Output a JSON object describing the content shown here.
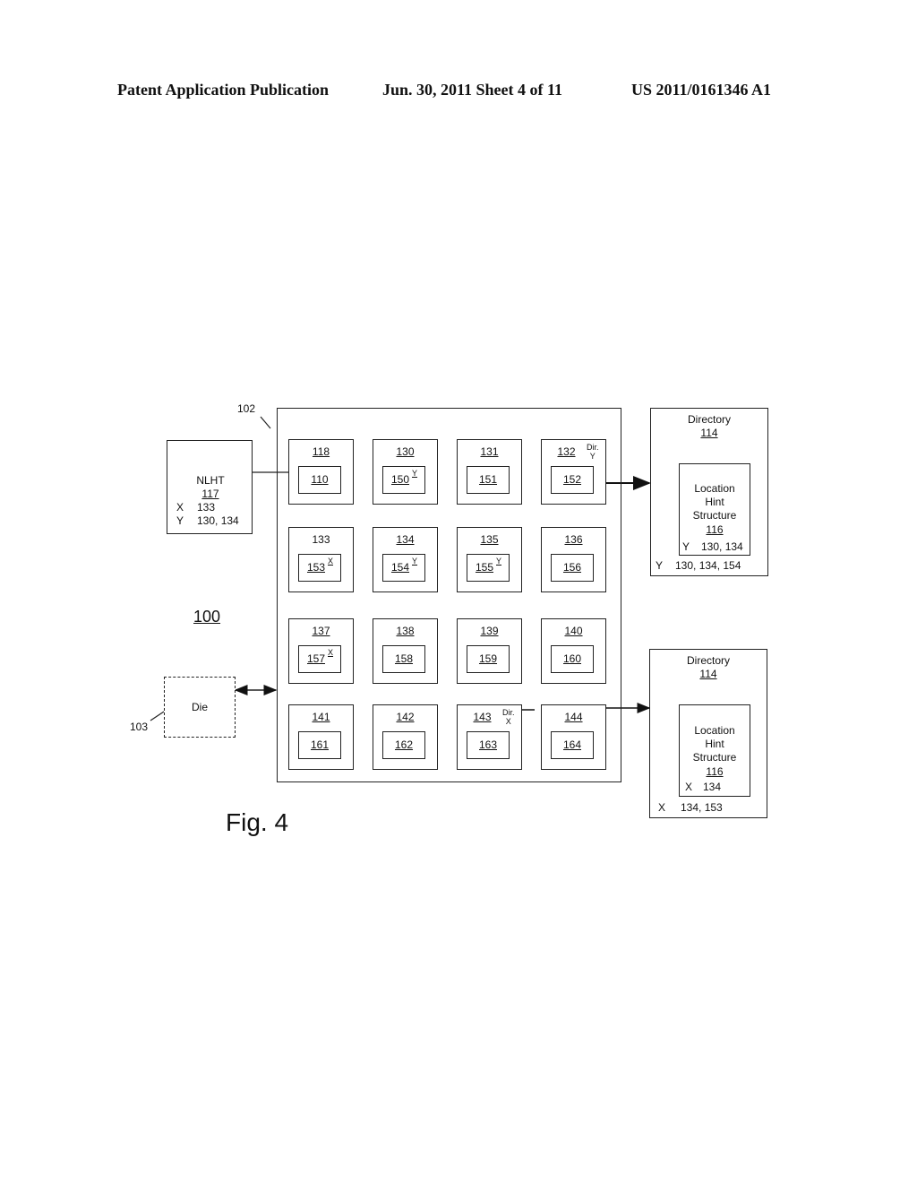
{
  "header": {
    "publication": "Patent Application Publication",
    "date_sheet": "Jun. 30, 2011  Sheet 4 of 11",
    "patent_number": "US 2011/0161346 A1"
  },
  "figure": {
    "caption": "Fig. 4",
    "system_ref": "100",
    "chip_ref": "102",
    "die_ref": "103",
    "die_label": "Die",
    "nlht": {
      "title": "NLHT",
      "ref": "117",
      "rows": [
        {
          "key": "X",
          "value": "133"
        },
        {
          "key": "Y",
          "value": "130, 134"
        }
      ]
    },
    "tiles": [
      {
        "tile": "118",
        "core": "110",
        "tile_underlined": true,
        "mark": ""
      },
      {
        "tile": "130",
        "core": "150",
        "tile_underlined": true,
        "mark": "Y"
      },
      {
        "tile": "131",
        "core": "151",
        "tile_underlined": true,
        "mark": ""
      },
      {
        "tile": "132",
        "core": "152",
        "tile_underlined": true,
        "mark": "",
        "dir": "Dir.",
        "dir_mark": "Y"
      },
      {
        "tile": "133",
        "core": "153",
        "tile_underlined": false,
        "mark": "X"
      },
      {
        "tile": "134",
        "core": "154",
        "tile_underlined": true,
        "mark": "Y"
      },
      {
        "tile": "135",
        "core": "155",
        "tile_underlined": true,
        "mark": "Y"
      },
      {
        "tile": "136",
        "core": "156",
        "tile_underlined": true,
        "mark": ""
      },
      {
        "tile": "137",
        "core": "157",
        "tile_underlined": true,
        "mark": "X"
      },
      {
        "tile": "138",
        "core": "158",
        "tile_underlined": true,
        "mark": ""
      },
      {
        "tile": "139",
        "core": "159",
        "tile_underlined": true,
        "mark": ""
      },
      {
        "tile": "140",
        "core": "160",
        "tile_underlined": true,
        "mark": ""
      },
      {
        "tile": "141",
        "core": "161",
        "tile_underlined": true,
        "mark": ""
      },
      {
        "tile": "142",
        "core": "162",
        "tile_underlined": true,
        "mark": ""
      },
      {
        "tile": "143",
        "core": "163",
        "tile_underlined": true,
        "mark": "",
        "dir": "Dir.",
        "dir_mark": "X"
      },
      {
        "tile": "144",
        "core": "164",
        "tile_underlined": true,
        "mark": ""
      }
    ],
    "directories": [
      {
        "title": "Directory",
        "ref": "114",
        "lhs_title_lines": [
          "Location",
          "Hint",
          "Structure"
        ],
        "lhs_ref": "116",
        "lhs_row": {
          "key": "Y",
          "value": "130, 134"
        },
        "dir_row": {
          "key": "Y",
          "value": "130, 134, 154"
        }
      },
      {
        "title": "Directory",
        "ref": "114",
        "lhs_title_lines": [
          "Location",
          "Hint",
          "Structure"
        ],
        "lhs_ref": "116",
        "lhs_row": {
          "key": "X",
          "value": "134"
        },
        "dir_row": {
          "key": "X",
          "value": "134, 153"
        }
      }
    ]
  }
}
